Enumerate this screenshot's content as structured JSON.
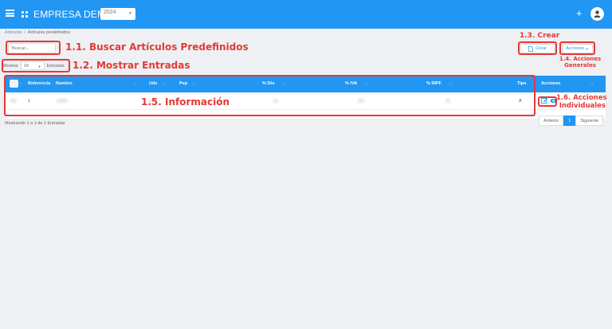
{
  "header": {
    "company": "EMPRESA DEMO1",
    "year": "2024"
  },
  "breadcrumb": {
    "root": "Artículos",
    "current": "Artículos predefinidos"
  },
  "search": {
    "placeholder": "Buscar..."
  },
  "entries": {
    "show_label": "Mostrar",
    "value": "10",
    "suffix": "Entradas"
  },
  "toolbar": {
    "create_label": "Crear",
    "actions_label": "Acciones"
  },
  "table": {
    "columns": [
      "Referencia",
      "Nombre",
      "Uds",
      "Pvp",
      "% Dto",
      "% IVA",
      "% IRPF",
      "Tipo",
      "Acciones"
    ],
    "rows": [
      {
        "referencia": "1",
        "tipo": "A"
      }
    ]
  },
  "footer": {
    "info": "Mostrando 1 a 1 de 1 Entradas",
    "prev": "Anterior",
    "page": "1",
    "next": "Siguiente"
  },
  "annotations": {
    "search": "1.1. Buscar Artículos Predefinidos",
    "entries": "1.2. Mostrar Entradas",
    "create": "1.3. Crear",
    "actions_line1": "1.4. Acciones",
    "actions_line2": "Generales",
    "info": "1.5. Información",
    "row_actions_line1": "1.6. Acciones",
    "row_actions_line2": "Individuales"
  },
  "colors": {
    "primary": "#2196f3",
    "annotation": "#e53935"
  }
}
